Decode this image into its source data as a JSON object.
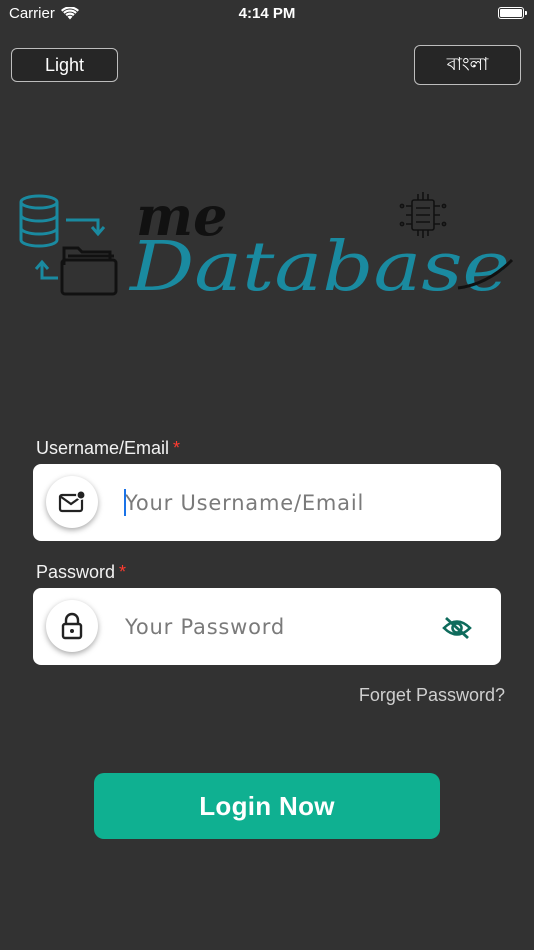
{
  "status_bar": {
    "carrier": "Carrier",
    "time": "4:14 PM"
  },
  "header": {
    "theme_toggle_label": "Light",
    "language_toggle_label": "বাংলা"
  },
  "logo": {
    "line1": "me",
    "line2": "Database"
  },
  "form": {
    "username": {
      "label": "Username/Email",
      "required_mark": "*",
      "placeholder": "Your Username/Email",
      "value": ""
    },
    "password": {
      "label": "Password",
      "required_mark": "*",
      "placeholder": "Your Password",
      "value": ""
    },
    "forgot_password_label": "Forget Password?",
    "login_label": "Login Now"
  },
  "colors": {
    "background": "#323232",
    "accent": "#0fb091",
    "logo_teal": "#1a8aa0",
    "required": "#ff3b30"
  }
}
